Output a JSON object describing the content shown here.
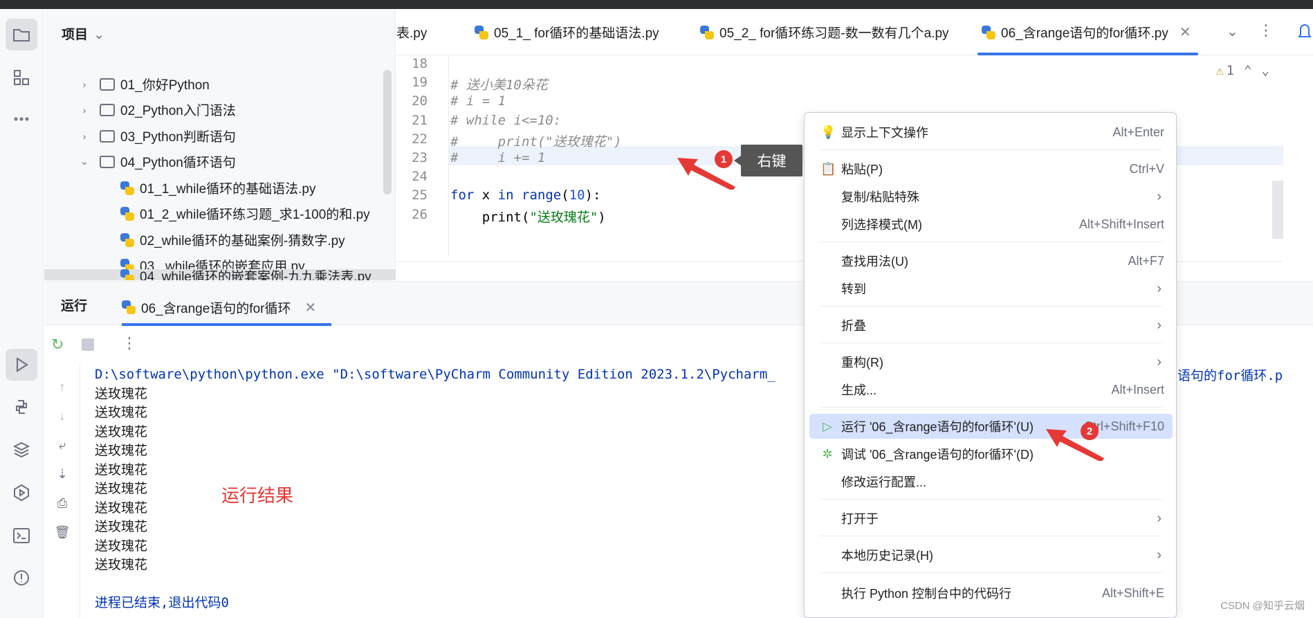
{
  "project_panel": {
    "title": "项目",
    "tree": [
      {
        "label": "01_你好Python",
        "type": "folder",
        "expanded": false
      },
      {
        "label": "02_Python入门语法",
        "type": "folder",
        "expanded": false
      },
      {
        "label": "03_Python判断语句",
        "type": "folder",
        "expanded": false
      },
      {
        "label": "04_Python循环语句",
        "type": "folder",
        "expanded": true
      },
      {
        "label": "01_1_while循环的基础语法.py",
        "type": "file"
      },
      {
        "label": "01_2_while循环练习题_求1-100的和.py",
        "type": "file"
      },
      {
        "label": "02_while循环的基础案例-猜数字.py",
        "type": "file"
      },
      {
        "label": "03_ while循环的嵌套应用.py",
        "type": "file"
      },
      {
        "label": "04_while循环的嵌套案例-九九乘法表.py",
        "type": "file"
      }
    ]
  },
  "tabs": [
    {
      "label": "表.py",
      "active": false
    },
    {
      "label": "05_1_ for循环的基础语法.py",
      "active": false
    },
    {
      "label": "05_2_ for循环练习题-数一数有几个a.py",
      "active": false
    },
    {
      "label": "06_含range语句的for循环.py",
      "active": true
    }
  ],
  "editor": {
    "warning_count": "1",
    "lines": [
      {
        "num": "18",
        "parts": []
      },
      {
        "num": "19",
        "parts": [
          {
            "t": "# 送小美10朵花",
            "c": "cmt"
          }
        ]
      },
      {
        "num": "20",
        "parts": [
          {
            "t": "# i = 1",
            "c": "cmt"
          }
        ]
      },
      {
        "num": "21",
        "parts": [
          {
            "t": "# while i<=10:",
            "c": "cmt"
          }
        ]
      },
      {
        "num": "22",
        "parts": [
          {
            "t": "#     print(\"送玫瑰花\")",
            "c": "cmt"
          }
        ]
      },
      {
        "num": "23",
        "parts": [
          {
            "t": "#     i += 1",
            "c": "cmt"
          }
        ]
      },
      {
        "num": "24",
        "parts": []
      },
      {
        "num": "25",
        "parts": [
          {
            "t": "for",
            "c": "kw"
          },
          {
            "t": " x ",
            "c": "fn"
          },
          {
            "t": "in",
            "c": "kw"
          },
          {
            "t": " ",
            "c": "fn"
          },
          {
            "t": "range",
            "c": "kw"
          },
          {
            "t": "(",
            "c": "fn"
          },
          {
            "t": "10",
            "c": "num"
          },
          {
            "t": "):",
            "c": "fn"
          }
        ]
      },
      {
        "num": "26",
        "parts": [
          {
            "t": "    print(",
            "c": "fn"
          },
          {
            "t": "\"送玫瑰花\"",
            "c": "str"
          },
          {
            "t": ")",
            "c": "fn"
          }
        ]
      }
    ]
  },
  "run_panel": {
    "title": "运行",
    "tab_label": "06_含range语句的for循环",
    "command": "D:\\software\\python\\python.exe \"D:\\software\\PyCharm Community Edition 2023.1.2\\Pycharm_",
    "command_tail": "语句的for循环.p",
    "output_lines": [
      "送玫瑰花",
      "送玫瑰花",
      "送玫瑰花",
      "送玫瑰花",
      "送玫瑰花",
      "送玫瑰花",
      "送玫瑰花",
      "送玫瑰花",
      "送玫瑰花",
      "送玫瑰花"
    ],
    "exit_text": "进程已结束,退出代码0",
    "annotation": "运行结果"
  },
  "context_menu": {
    "items": [
      {
        "label": "显示上下文操作",
        "shortcut": "Alt+Enter",
        "icon": "bulb-icon"
      },
      {
        "label": "粘贴(P)",
        "shortcut": "Ctrl+V",
        "icon": "clipboard-icon"
      },
      {
        "label": "复制/粘贴特殊",
        "submenu": true
      },
      {
        "label": "列选择模式(M)",
        "shortcut": "Alt+Shift+Insert"
      },
      {
        "label": "查找用法(U)",
        "shortcut": "Alt+F7"
      },
      {
        "label": "转到",
        "submenu": true
      },
      {
        "label": "折叠",
        "submenu": true
      },
      {
        "label": "重构(R)",
        "submenu": true
      },
      {
        "label": "生成...",
        "shortcut": "Alt+Insert"
      },
      {
        "label": "运行 '06_含range语句的for循环'(U)",
        "shortcut": "Ctrl+Shift+F10",
        "icon": "run-icon",
        "highlight": true
      },
      {
        "label": "调试 '06_含range语句的for循环'(D)",
        "icon": "debug-icon"
      },
      {
        "label": "修改运行配置..."
      },
      {
        "label": "打开于",
        "submenu": true
      },
      {
        "label": "本地历史记录(H)",
        "submenu": true
      },
      {
        "label": "执行 Python 控制台中的代码行",
        "shortcut": "Alt+Shift+E"
      }
    ]
  },
  "annotations": {
    "badge1": "1",
    "badge2": "2",
    "right_click_label": "右键"
  },
  "watermark": "CSDN @知乎云烟",
  "colors": {
    "accent": "#3574f0",
    "annotation_red": "#e53935",
    "menu_highlight": "#d5e1ff"
  }
}
